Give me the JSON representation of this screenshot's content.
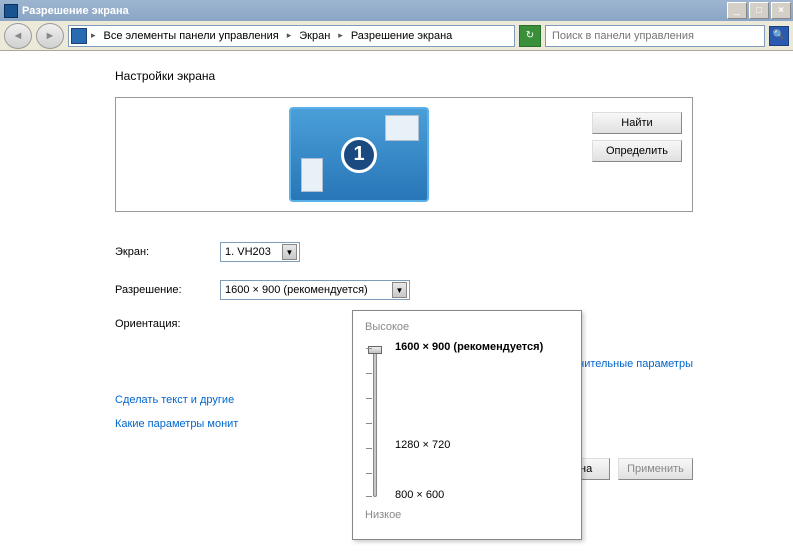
{
  "window": {
    "title": "Разрешение экрана",
    "minimize": "_",
    "maximize": "□",
    "close": "×"
  },
  "breadcrumb": {
    "parts": [
      "Все элементы панели управления",
      "Экран",
      "Разрешение экрана"
    ]
  },
  "search": {
    "placeholder": "Поиск в панели управления"
  },
  "page": {
    "heading": "Настройки экрана",
    "monitor_number": "1",
    "find_button": "Найти",
    "identify_button": "Определить"
  },
  "fields": {
    "screen_label": "Экран:",
    "screen_value": "1. VH203",
    "resolution_label": "Разрешение:",
    "resolution_value": "1600 × 900 (рекомендуется)",
    "orientation_label": "Ориентация:"
  },
  "links": {
    "advanced": "Дополнительные параметры",
    "text_size": "Сделать текст и другие",
    "monitor_params": "Какие параметры монит"
  },
  "buttons": {
    "cancel": "Отмена",
    "apply": "Применить"
  },
  "slider": {
    "high": "Высокое",
    "low": "Низкое",
    "current": "1600 × 900 (рекомендуется)",
    "mid": "1280 × 720",
    "min": "800 × 600"
  }
}
